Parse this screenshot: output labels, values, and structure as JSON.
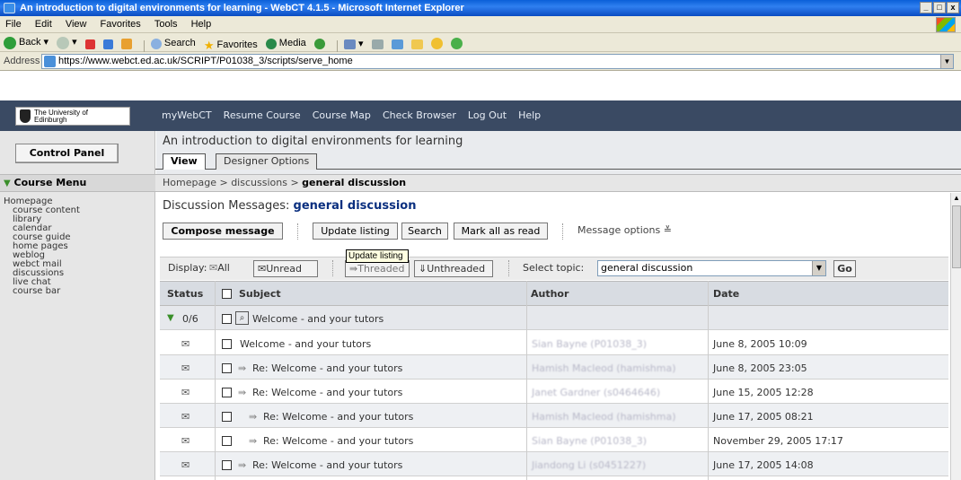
{
  "browser": {
    "title": "An introduction to digital environments for learning - WebCT 4.1.5 - Microsoft Internet Explorer",
    "window_controls": [
      "_",
      "□",
      "x"
    ],
    "menu": [
      "File",
      "Edit",
      "View",
      "Favorites",
      "Tools",
      "Help"
    ],
    "toolbar": {
      "back": "Back",
      "search": "Search",
      "favorites": "Favorites",
      "media": "Media"
    },
    "address_label": "Address",
    "url": "https://www.webct.ed.ac.uk/SCRIPT/P01038_3/scripts/serve_home"
  },
  "banner": {
    "logo_line1": "The University of",
    "logo_line2": "Edinburgh",
    "nav": [
      "myWebCT",
      "Resume Course",
      "Course Map",
      "Check Browser",
      "Log Out",
      "Help"
    ]
  },
  "left_panel": {
    "control_panel": "Control Panel",
    "course_menu": "Course Menu",
    "homepage": "Homepage",
    "items": [
      "course content",
      "library",
      "calendar",
      "course guide",
      "home pages",
      "weblog",
      "webct mail",
      "discussions",
      "live chat",
      "course bar"
    ]
  },
  "header": {
    "course_title": "An introduction to digital environments for learning",
    "tabs": [
      "View",
      "Designer Options"
    ],
    "breadcrumb": {
      "part1": "Homepage",
      "sep": ">",
      "part2": "discussions",
      "current": "general discussion"
    }
  },
  "discussion": {
    "title_prefix": "Discussion Messages: ",
    "topic": "general discussion",
    "buttons": {
      "compose": "Compose message",
      "update": "Update listing",
      "search": "Search",
      "mark_all": "Mark all as read"
    },
    "message_options": "Message options ≚",
    "tooltip": "Update listing",
    "filter": {
      "display_label": "Display:",
      "all": "All",
      "unread": "Unread",
      "threaded": "Threaded",
      "unthreaded": "Unthreaded",
      "select_topic_label": "Select topic:",
      "selected_topic": "general discussion",
      "go": "Go"
    },
    "columns": [
      "Status",
      "Subject",
      "Author",
      "Date"
    ],
    "thread": {
      "status": "0/6",
      "subject": "Welcome - and your tutors"
    },
    "messages": [
      {
        "subject": "Welcome - and your tutors",
        "author": "Sian Bayne (P01038_3)",
        "date": "June 8, 2005 10:09"
      },
      {
        "subject": "Re: Welcome - and your tutors",
        "author": "Hamish Macleod (hamishma)",
        "date": "June 8, 2005 23:05"
      },
      {
        "subject": "Re: Welcome - and your tutors",
        "author": "Janet Gardner (s0464646)",
        "date": "June 15, 2005 12:28"
      },
      {
        "subject": "Re: Welcome - and your tutors",
        "author": "Hamish Macleod (hamishma)",
        "date": "June 17, 2005 08:21"
      },
      {
        "subject": "Re: Welcome - and your tutors",
        "author": "Sian Bayne (P01038_3)",
        "date": "November 29, 2005 17:17"
      },
      {
        "subject": "Re: Welcome - and your tutors",
        "author": "Jiandong Li (s0451227)",
        "date": "June 17, 2005 14:08"
      }
    ]
  },
  "colors": {
    "banner": "#3a4a63",
    "topic": "#0a2f7f",
    "xp_title": "#0a5fd8"
  }
}
